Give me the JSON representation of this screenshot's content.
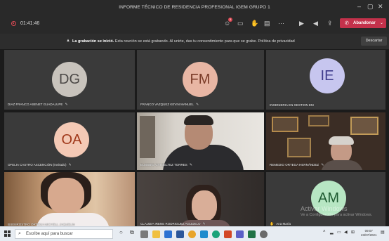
{
  "window": {
    "title": "INFORME TÉCNICO DE RESIDENCIA PROFESIONAL IGEM GRUPO 1"
  },
  "toolbar": {
    "timer": "01:41:46",
    "chat_badge_count": "3",
    "leave_label": "Abandonar"
  },
  "banner": {
    "bold_text": "La grabación se inició.",
    "text": " Esta reunión se está grabando. Al unirte, das tu consentimiento para que se grabe. Política de privacidad",
    "dismiss_label": "Descartar"
  },
  "participants": [
    {
      "initials": "DG",
      "name": "DIAZ FRANCO ASENET GUADALUPE",
      "avatar_bg": "#c8c3bc",
      "avatar_fg": "#4b4846"
    },
    {
      "initials": "FM",
      "name": "FRANCO VAZQUEZ KEVIN MANUEL",
      "avatar_bg": "#e8b6a4",
      "avatar_fg": "#7a3b28"
    },
    {
      "initials": "IE",
      "name": "INGENIERIA EN GESTION EM",
      "avatar_bg": "#c7c6ef",
      "avatar_fg": "#3f3c8c"
    },
    {
      "initials": "OA",
      "name": "OFELIA CASTRO ASCENCIÓN (Invitado)",
      "avatar_bg": "#f4c9b5",
      "avatar_fg": "#a0381a"
    },
    {
      "initials": "",
      "name": "EUSEBIO CHI BELTEZ TORRES"
    },
    {
      "initials": "",
      "name": "REMEDIO ORTEGA HERNÁNDEZ"
    },
    {
      "initials": "",
      "name": "BUENROSTRO ORTEGA MICHELL JAQUELIN"
    },
    {
      "initials": "",
      "name": "CLAUDIA IRENE RODRIGUEZ AGUDELO"
    },
    {
      "initials": "AM",
      "name": "Ana María",
      "avatar_bg": "#b7e6c3",
      "avatar_fg": "#1f5a31"
    }
  ],
  "watermark": {
    "line1": "Activar Windows",
    "line2": "Ve a Configuración para activar Windows."
  },
  "taskbar": {
    "search_placeholder": "Escribe aquí para buscar",
    "time": "09:07",
    "date": "23/07/2021"
  }
}
